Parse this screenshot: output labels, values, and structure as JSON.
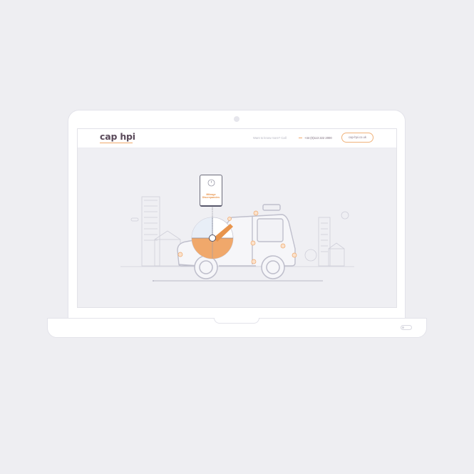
{
  "site": {
    "logo_text": "cap hpi",
    "know_more_text": "Want to know more? Call",
    "phone": "+44 (0)113 222 2000",
    "website_button": "cap-hpi.co.uk"
  },
  "illustration": {
    "card_label_line1": "Mileage",
    "card_label_line2": "Discrepancies"
  },
  "colors": {
    "background": "#eeeef2",
    "accent_orange": "#f0a86b",
    "logo": "#5a4a5a",
    "outline": "#c8c8d4"
  },
  "icons": {
    "card_icon": "clock-icon",
    "toggle": "switch-icon"
  }
}
